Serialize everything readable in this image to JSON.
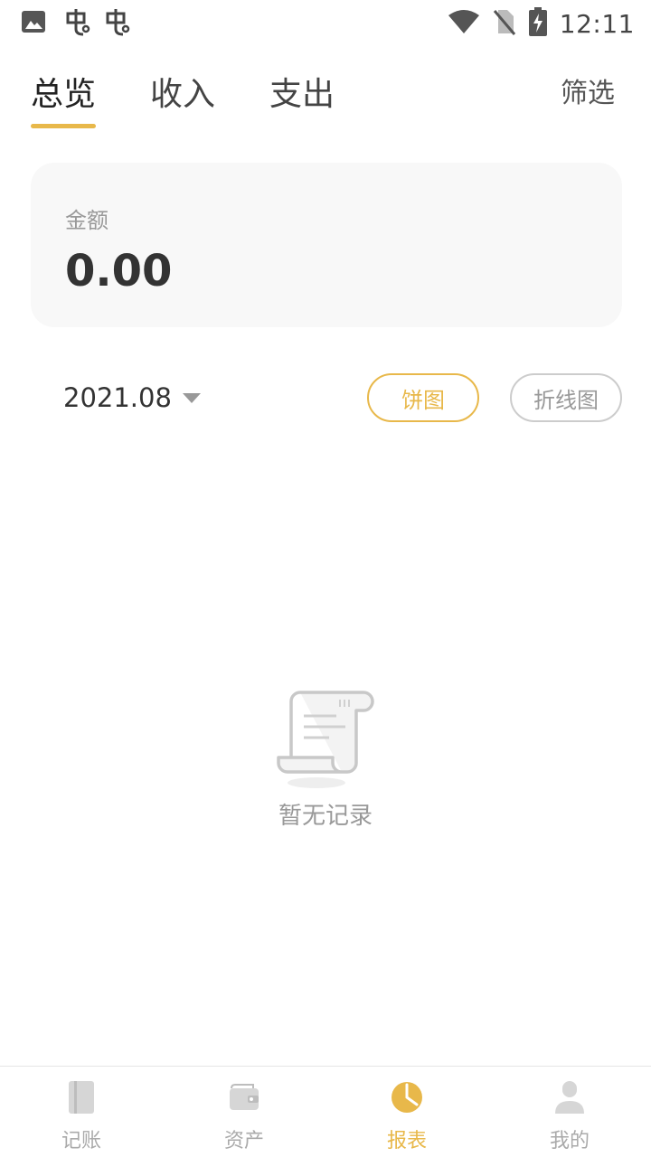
{
  "theme": {
    "accent": "#E8B84A",
    "inactive_border": "#CCCCCC",
    "text_primary": "#333333",
    "text_muted": "#999999"
  },
  "status_bar": {
    "time": "12:11",
    "left_icons": [
      "image-icon",
      "app-notification-icon",
      "app-notification-icon"
    ],
    "right_icons": [
      "wifi-icon",
      "no-sim-icon",
      "battery-charging-icon"
    ]
  },
  "tabs": {
    "items": [
      {
        "label": "总览",
        "active": true
      },
      {
        "label": "收入",
        "active": false
      },
      {
        "label": "支出",
        "active": false
      }
    ],
    "filter_label": "筛选"
  },
  "summary": {
    "label": "金额",
    "value": "0.00"
  },
  "period": {
    "value": "2021.08"
  },
  "chart_toggle": {
    "pie_label": "饼图",
    "line_label": "折线图",
    "selected": "pie"
  },
  "empty_state": {
    "icon": "receipt-scroll-icon",
    "text": "暂无记录"
  },
  "bottom_nav": {
    "items": [
      {
        "label": "记账",
        "icon": "notebook-icon",
        "active": false
      },
      {
        "label": "资产",
        "icon": "wallet-icon",
        "active": false
      },
      {
        "label": "报表",
        "icon": "pie-chart-icon",
        "active": true
      },
      {
        "label": "我的",
        "icon": "user-icon",
        "active": false
      }
    ]
  }
}
